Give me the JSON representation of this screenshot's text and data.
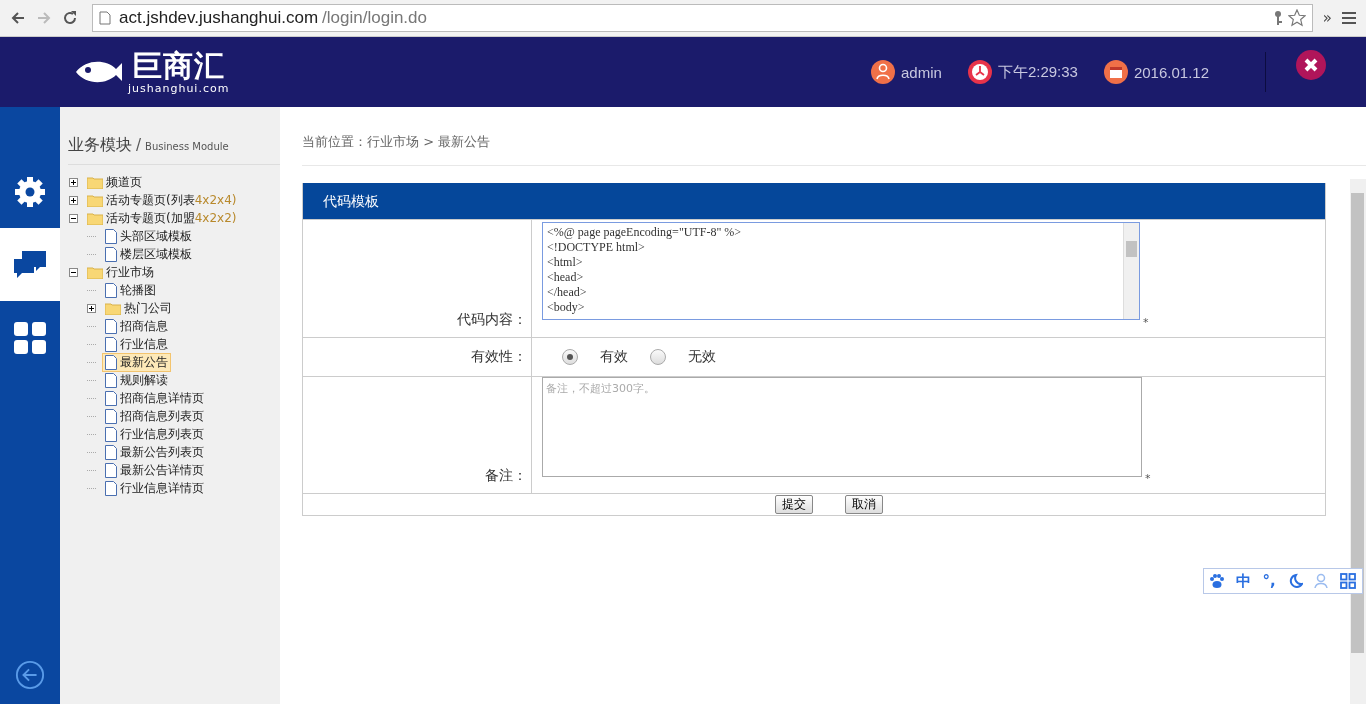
{
  "browser": {
    "url_host": "act.jshdev.jushanghui.com",
    "url_path": "/login/login.do",
    "overflow": "»"
  },
  "header": {
    "logo_text": "巨商汇",
    "logo_domain": "jushanghui.com",
    "user": "admin",
    "time": "下午2:29:33",
    "date": "2016.01.12"
  },
  "rail": [
    {
      "kind": "settings",
      "selected": false
    },
    {
      "kind": "chat",
      "selected": true
    },
    {
      "kind": "grid",
      "selected": false
    }
  ],
  "sidebar": {
    "title": "业务模块",
    "separator": "/",
    "subtitle": "Business Module",
    "tree": [
      {
        "label": "频道页",
        "kind": "folder",
        "expanded": false,
        "selected": false
      },
      {
        "label": "活动专题页(列表",
        "suffix": "4x2x4)",
        "kind": "folder",
        "expanded": false,
        "selected": false
      },
      {
        "label": "活动专题页(加盟",
        "suffix": "4x2x2)",
        "kind": "folder",
        "expanded": true,
        "selected": false,
        "children": [
          {
            "label": "头部区域模板",
            "kind": "file",
            "selected": false
          },
          {
            "label": "楼层区域模板",
            "kind": "file",
            "selected": false
          }
        ]
      },
      {
        "label": "行业市场",
        "kind": "folder",
        "expanded": true,
        "selected": false,
        "children": [
          {
            "label": "轮播图",
            "kind": "file",
            "selected": false
          },
          {
            "label": "热门公司",
            "kind": "folder",
            "expanded": false,
            "selected": false
          },
          {
            "label": "招商信息",
            "kind": "file",
            "selected": false
          },
          {
            "label": "行业信息",
            "kind": "file",
            "selected": false
          },
          {
            "label": "最新公告",
            "kind": "file",
            "selected": true
          },
          {
            "label": "规则解读",
            "kind": "file",
            "selected": false
          },
          {
            "label": "招商信息详情页",
            "kind": "file",
            "selected": false
          },
          {
            "label": "招商信息列表页",
            "kind": "file",
            "selected": false
          },
          {
            "label": "行业信息列表页",
            "kind": "file",
            "selected": false
          },
          {
            "label": "最新公告列表页",
            "kind": "file",
            "selected": false
          },
          {
            "label": "最新公告详情页",
            "kind": "file",
            "selected": false
          },
          {
            "label": "行业信息详情页",
            "kind": "file",
            "selected": false
          }
        ]
      }
    ]
  },
  "breadcrumb": "当前位置：行业市场 > 最新公告",
  "form": {
    "title": "代码模板",
    "code_label": "代码内容：",
    "code_lines": [
      "<%@ page pageEncoding=\"UTF-8\" %>",
      "<!DOCTYPE html>",
      "<html>",
      "<head>",
      "</head>",
      "<body>"
    ],
    "required_mark_1": "*",
    "validity_label": "有效性：",
    "options": [
      {
        "label": "有效",
        "selected": true
      },
      {
        "label": "无效",
        "selected": false
      }
    ],
    "note_label": "备注：",
    "note_placeholder": "备注，不超过300字。",
    "required_mark_2": "*",
    "buttons": [
      "提交",
      "取消"
    ]
  },
  "ime_bar": {
    "lang": "中",
    "punct": "°,"
  }
}
